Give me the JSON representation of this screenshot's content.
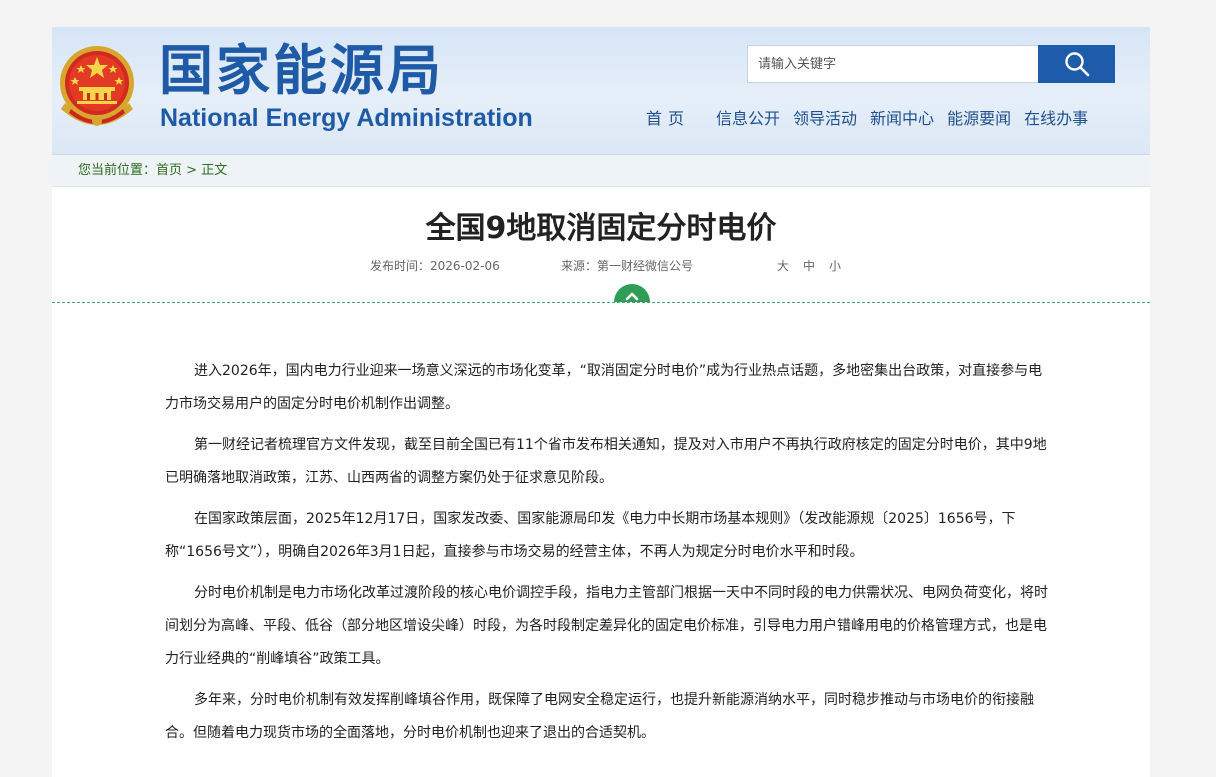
{
  "header": {
    "title_cn": "国家能源局",
    "title_en": "National Energy Administration",
    "search_placeholder": "请输入关键字",
    "nav": [
      {
        "label": "首页"
      },
      {
        "label": "信息公开"
      },
      {
        "label": "领导活动"
      },
      {
        "label": "新闻中心"
      },
      {
        "label": "能源要闻"
      },
      {
        "label": "在线办事"
      }
    ]
  },
  "breadcrumb": {
    "prefix": "您当前位置：",
    "home": "首页",
    "separator": " > ",
    "current": "正文"
  },
  "article": {
    "title": "全国9地取消固定分时电价",
    "publish_time": "发布时间：2026-02-06",
    "source": "来源：第一财经微信公号",
    "font_sizes": [
      "大",
      "中",
      "小"
    ],
    "paragraphs": [
      "进入2026年，国内电力行业迎来一场意义深远的市场化变革，“取消固定分时电价”成为行业热点话题，多地密集出台政策，对直接参与电力市场交易用户的固定分时电价机制作出调整。",
      "第一财经记者梳理官方文件发现，截至目前全国已有11个省市发布相关通知，提及对入市用户不再执行政府核定的固定分时电价，其中9地已明确落地取消政策，江苏、山西两省的调整方案仍处于征求意见阶段。",
      "在国家政策层面，2025年12月17日，国家发改委、国家能源局印发《电力中长期市场基本规则》（发改能源规〔2025〕1656号，下称“1656号文”），明确自2026年3月1日起，直接参与市场交易的经营主体，不再人为规定分时电价水平和时段。",
      "分时电价机制是电力市场化改革过渡阶段的核心电价调控手段，指电力主管部门根据一天中不同时段的电力供需状况、电网负荷变化，将时间划分为高峰、平段、低谷（部分地区增设尖峰）时段，为各时段制定差异化的固定电价标准，引导电力用户错峰用电的价格管理方式，也是电力行业经典的“削峰填谷”政策工具。",
      "多年来，分时电价机制有效发挥削峰填谷作用，既保障了电网安全稳定运行，也提升新能源消纳水平，同时稳步推动与市场电价的衔接融合。但随着电力现货市场的全面落地，分时电价机制也迎来了退出的合适契机。"
    ]
  },
  "colors": {
    "brand_blue": "#1f5aa6",
    "search_button": "#1e5bab",
    "breadcrumb_green": "#2c6d1e",
    "divider_green": "#2f9c57"
  },
  "icons": {
    "emblem": "national-emblem-icon",
    "search": "search-icon",
    "collapse": "chevron-up-icon"
  }
}
